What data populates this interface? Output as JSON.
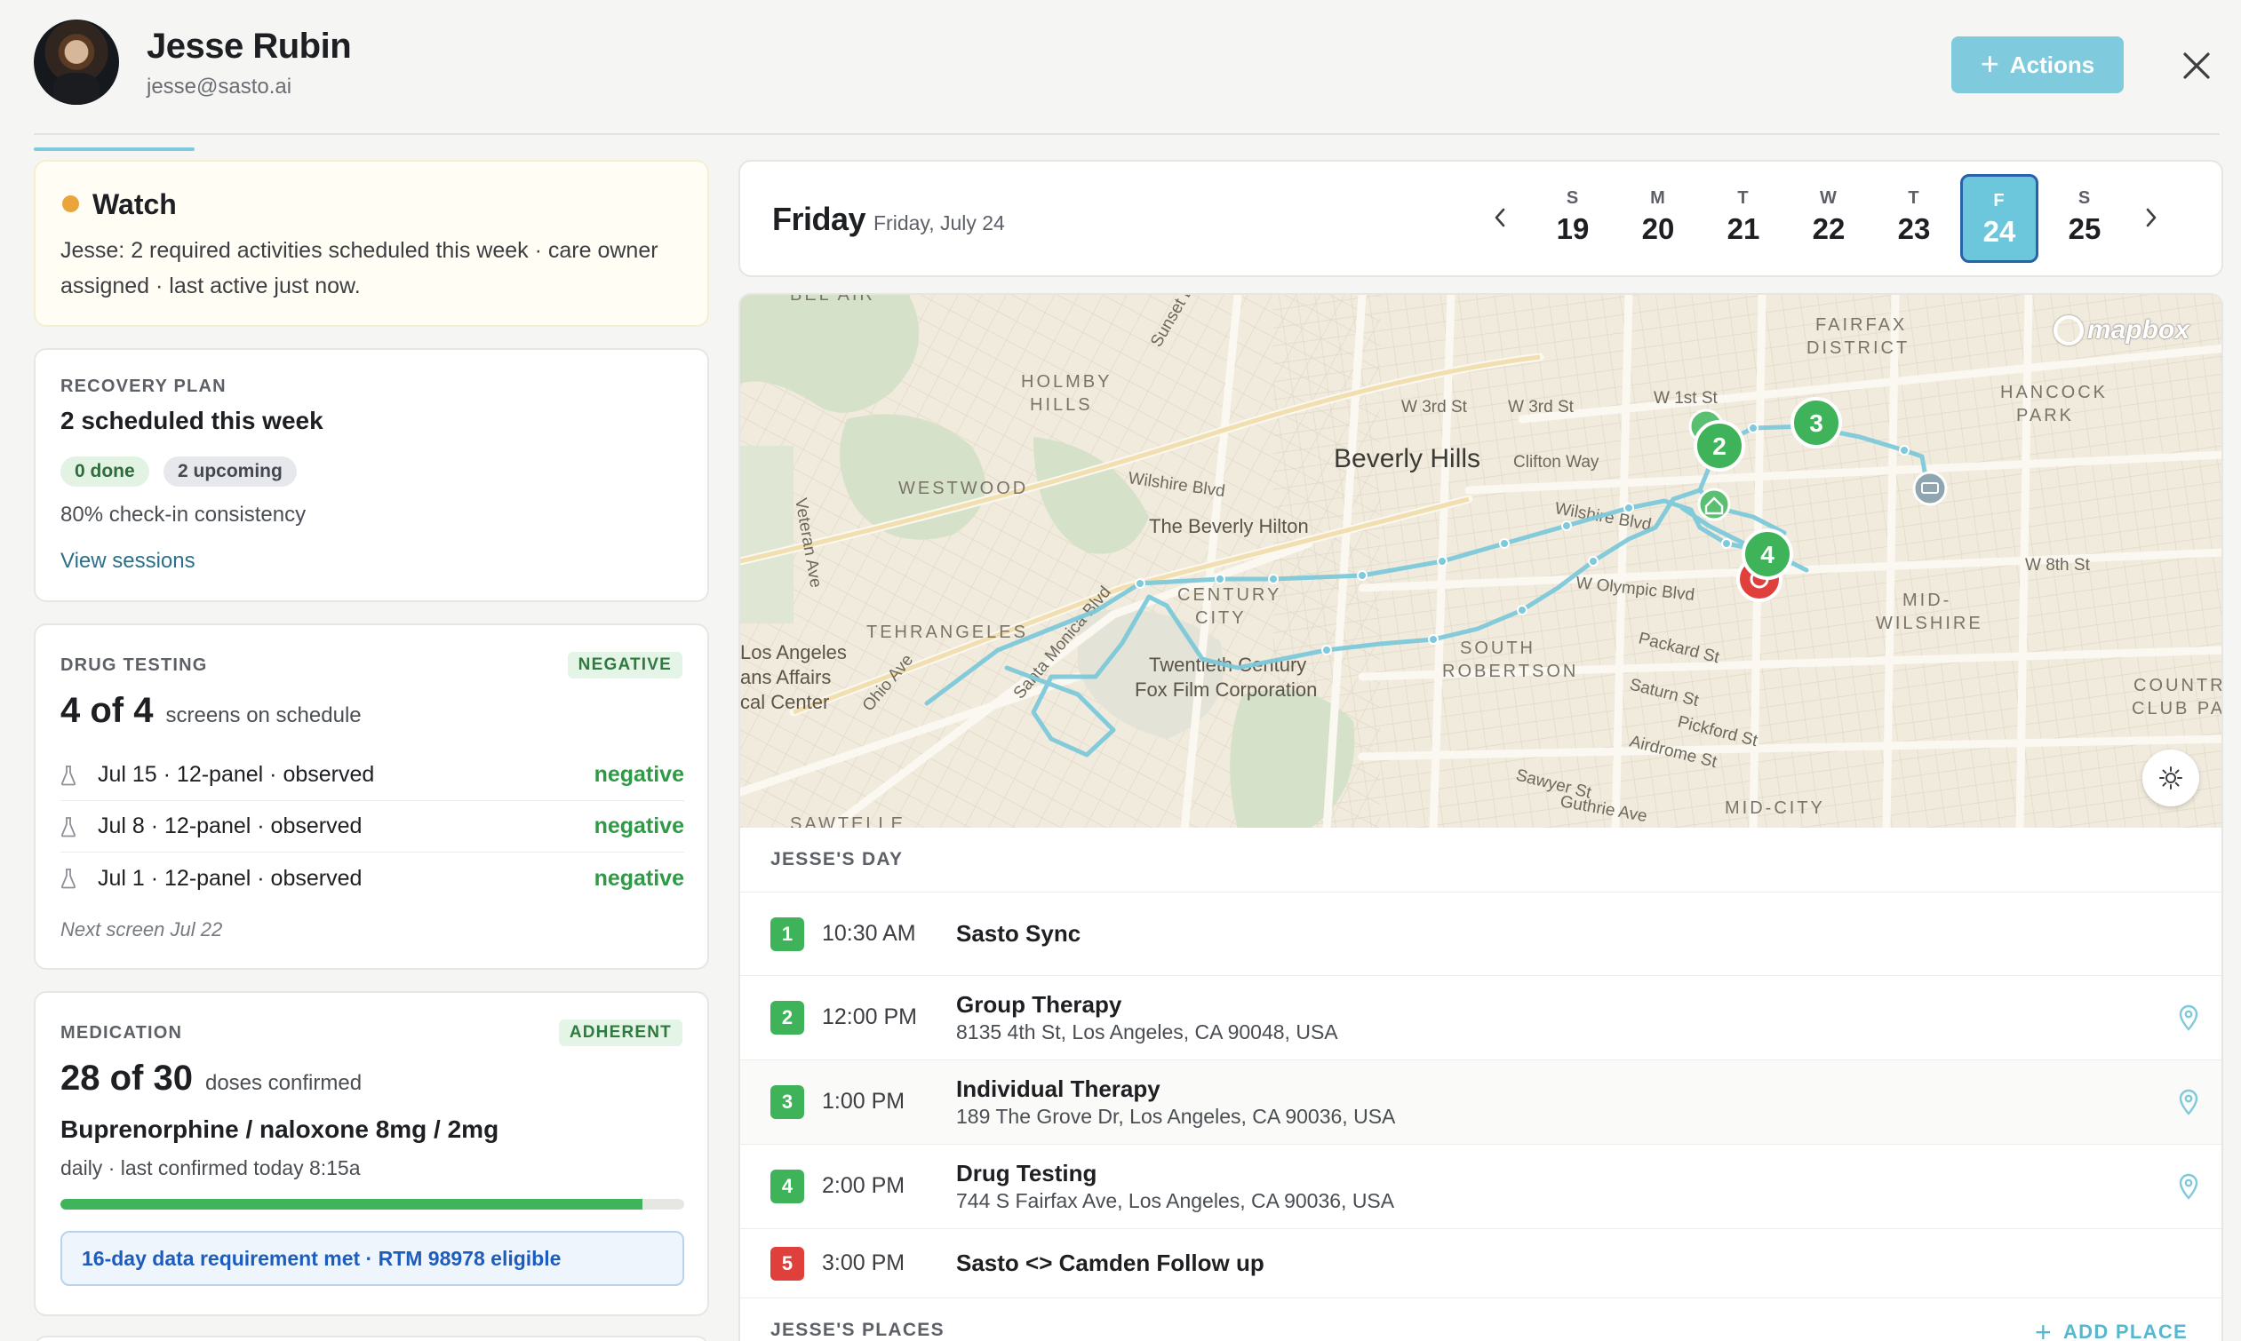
{
  "header": {
    "name": "Jesse Rubin",
    "email": "jesse@sasto.ai",
    "actions_label": "Actions",
    "accent_color": "#7fcbdd"
  },
  "watch": {
    "title": "Watch",
    "text": "Jesse: 2 required activities scheduled this week · care owner assigned · last active just now.",
    "status_color": "#eba43a"
  },
  "recovery": {
    "caption": "RECOVERY PLAN",
    "heading": "2 scheduled this week",
    "pill_done": "0 done",
    "pill_upcoming": "2 upcoming",
    "consistency": "80% check-in consistency",
    "link": "View sessions"
  },
  "drug_testing": {
    "caption": "DRUG TESTING",
    "badge": "NEGATIVE",
    "count": "4 of 4",
    "count_sub": "screens on schedule",
    "tests": [
      {
        "label": "Jul 15 · 12-panel · observed",
        "result": "negative"
      },
      {
        "label": "Jul 8 · 12-panel · observed",
        "result": "negative"
      },
      {
        "label": "Jul 1 · 12-panel · observed",
        "result": "negative"
      }
    ],
    "next": "Next screen Jul 22"
  },
  "medication": {
    "caption": "MEDICATION",
    "badge": "ADHERENT",
    "count": "28 of 30",
    "count_sub": "doses confirmed",
    "drug": "Buprenorphine / naloxone 8mg / 2mg",
    "schedule": "daily · last confirmed today 8:15a",
    "progress": 0.933,
    "rtm": "16-day data requirement met · RTM 98978 eligible"
  },
  "calendar": {
    "day_name": "Friday",
    "full_date": "Friday, July 24",
    "days": [
      {
        "letter": "S",
        "num": "19"
      },
      {
        "letter": "M",
        "num": "20"
      },
      {
        "letter": "T",
        "num": "21"
      },
      {
        "letter": "W",
        "num": "22"
      },
      {
        "letter": "T",
        "num": "23"
      },
      {
        "letter": "F",
        "num": "24",
        "selected": true
      },
      {
        "letter": "S",
        "num": "25"
      }
    ]
  },
  "map": {
    "attribution": "mapbox",
    "labels": {
      "bel_air": "BEL AIR",
      "holmby_hills": "HOLMBY",
      "holmby_hills2": "HILLS",
      "westwood": "WESTWOOD",
      "beverly_hills": "Beverly Hills",
      "beverly_hilton": "The Beverly Hilton",
      "century_city": "CENTURY",
      "century_city2": "CITY",
      "tehrangeles": "TEHRANGELES",
      "la_va": "Los Angeles",
      "la_va2": "ans Affairs",
      "la_va3": "cal Center",
      "fox": "Twentieth Century",
      "fox2": "Fox Film Corporation",
      "south_robertson": "SOUTH",
      "south_robertson2": "ROBERTSON",
      "fairfax": "FAIRFAX",
      "fairfax2": "DISTRICT",
      "hancock": "HANCOCK",
      "hancock2": "PARK",
      "mid_wilshire": "MID-",
      "mid_wilshire2": "WILSHIRE",
      "country_club": "COUNTR",
      "country_club2": "CLUB PA",
      "mid_city": "MID-CITY",
      "sawtelle": "SAWTELLE",
      "wilshire_blvd": "Wilshire Blvd",
      "wilshire_blvd2": "Wilshire Blvd",
      "olympic": "W Olympic Blvd",
      "w3rd": "W 3rd St",
      "w3rd2": "W 3rd St",
      "w1st": "W 1st St",
      "clifton": "Clifton Way",
      "santa_monica": "Santa Monica Blvd",
      "packard": "Packard St",
      "saturn": "Saturn St",
      "pickford": "Pickford St",
      "airdrome": "Airdrome St",
      "sawyer": "Sawyer St",
      "guthrie": "Guthrie Ave",
      "veteran": "Veteran Ave",
      "ohio": "Ohio Ave",
      "w8th": "W 8th St",
      "sunset": "Sunset Bl",
      "marker_labels": [
        "2",
        "3",
        "4"
      ]
    }
  },
  "jesses_day": {
    "title": "JESSE'S DAY",
    "activities": [
      {
        "num": "1",
        "time": "10:30 AM",
        "title": "Sasto Sync",
        "address": "",
        "color": "#3fb35a"
      },
      {
        "num": "2",
        "time": "12:00 PM",
        "title": "Group Therapy",
        "address": "8135 4th St, Los Angeles, CA 90048, USA",
        "color": "#3fb35a"
      },
      {
        "num": "3",
        "time": "1:00 PM",
        "title": "Individual Therapy",
        "address": "189 The Grove Dr, Los Angeles, CA 90036, USA",
        "color": "#3fb35a"
      },
      {
        "num": "4",
        "time": "2:00 PM",
        "title": "Drug Testing",
        "address": "744 S Fairfax Ave, Los Angeles, CA 90036, USA",
        "color": "#3fb35a"
      },
      {
        "num": "5",
        "time": "3:00 PM",
        "title": "Sasto <> Camden Follow up",
        "address": "",
        "color": "#e0403c"
      }
    ]
  },
  "jesses_places": {
    "title": "JESSE'S PLACES",
    "add_label": "ADD PLACE"
  }
}
